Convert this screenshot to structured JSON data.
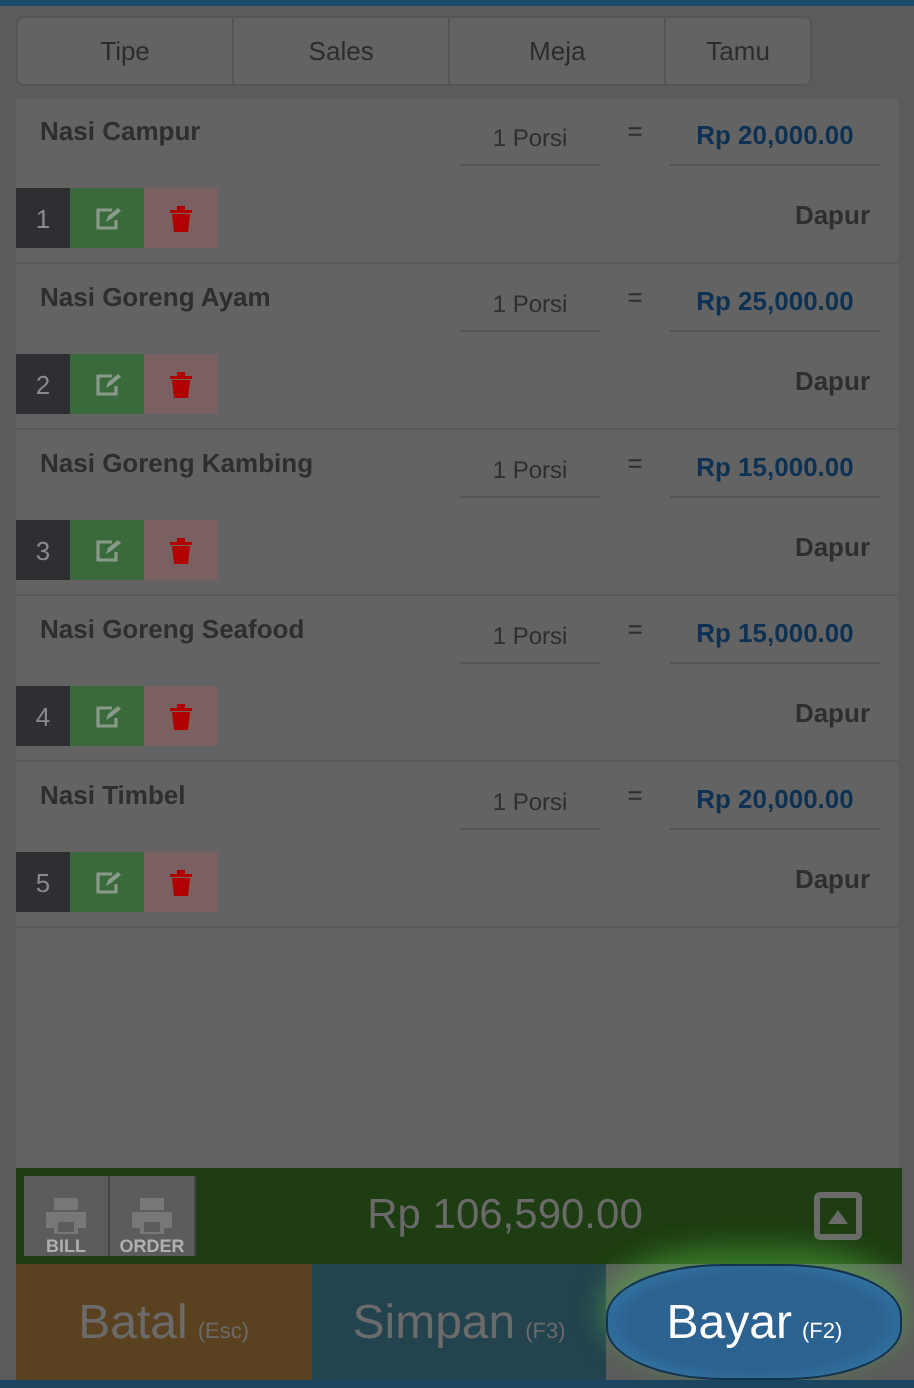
{
  "tabs": [
    {
      "label": "Tipe"
    },
    {
      "label": "Sales"
    },
    {
      "label": "Meja"
    },
    {
      "label": "Tamu"
    }
  ],
  "items": [
    {
      "name": "Nasi Campur",
      "qty": "1 Porsi",
      "equals": "=",
      "price": "Rp 20,000.00",
      "number": "1",
      "station": "Dapur"
    },
    {
      "name": "Nasi Goreng Ayam",
      "qty": "1 Porsi",
      "equals": "=",
      "price": "Rp 25,000.00",
      "number": "2",
      "station": "Dapur"
    },
    {
      "name": "Nasi Goreng Kambing",
      "qty": "1 Porsi",
      "equals": "=",
      "price": "Rp 15,000.00",
      "number": "3",
      "station": "Dapur"
    },
    {
      "name": "Nasi Goreng Seafood",
      "qty": "1 Porsi",
      "equals": "=",
      "price": "Rp 15,000.00",
      "number": "4",
      "station": "Dapur"
    },
    {
      "name": "Nasi Timbel",
      "qty": "1 Porsi",
      "equals": "=",
      "price": "Rp 20,000.00",
      "number": "5",
      "station": "Dapur"
    }
  ],
  "footer": {
    "print_buttons": [
      {
        "label": "BILL"
      },
      {
        "label": "ORDER"
      }
    ],
    "total": "Rp 106,590.00",
    "actions": [
      {
        "kind": "cancel",
        "label": "Batal",
        "shortcut": "(Esc)",
        "highlighted": false
      },
      {
        "kind": "save",
        "label": "Simpan",
        "shortcut": "(F3)",
        "highlighted": false
      },
      {
        "kind": "pay",
        "label": "Bayar",
        "shortcut": "(F2)",
        "highlighted": true
      }
    ]
  }
}
